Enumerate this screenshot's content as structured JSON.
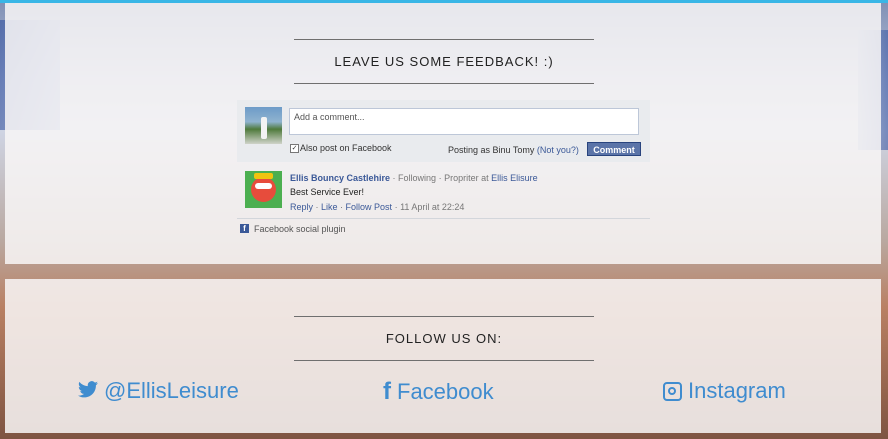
{
  "feedback": {
    "heading": "LEAVE US SOME FEEDBACK! :)",
    "comment_placeholder": "Add a comment...",
    "also_post_label": "Also post on Facebook",
    "posting_as": "Posting as Binu Tomy",
    "not_you": "(Not you?)",
    "comment_button": "Comment",
    "comments": [
      {
        "author": "Ellis Bouncy Castlehire",
        "sep1": " · ",
        "following": "Following",
        "sep2": " · ",
        "role": "Propriter at ",
        "company": "Ellis Elisure",
        "text": "Best Service Ever!",
        "reply": "Reply",
        "like": "Like",
        "follow_post": "Follow Post",
        "date": "11 April at 22:24"
      }
    ],
    "plugin_label": "Facebook social plugin"
  },
  "follow": {
    "heading": "FOLLOW US ON:",
    "links": [
      {
        "icon": "twitter-icon",
        "label": "@EllisLeisure"
      },
      {
        "icon": "facebook-icon",
        "label": "Facebook"
      },
      {
        "icon": "instagram-icon",
        "label": "Instagram"
      }
    ]
  },
  "colors": {
    "link_blue": "#3f8ccf",
    "facebook_blue": "#3b5998",
    "top_accent": "#39b6e6"
  }
}
